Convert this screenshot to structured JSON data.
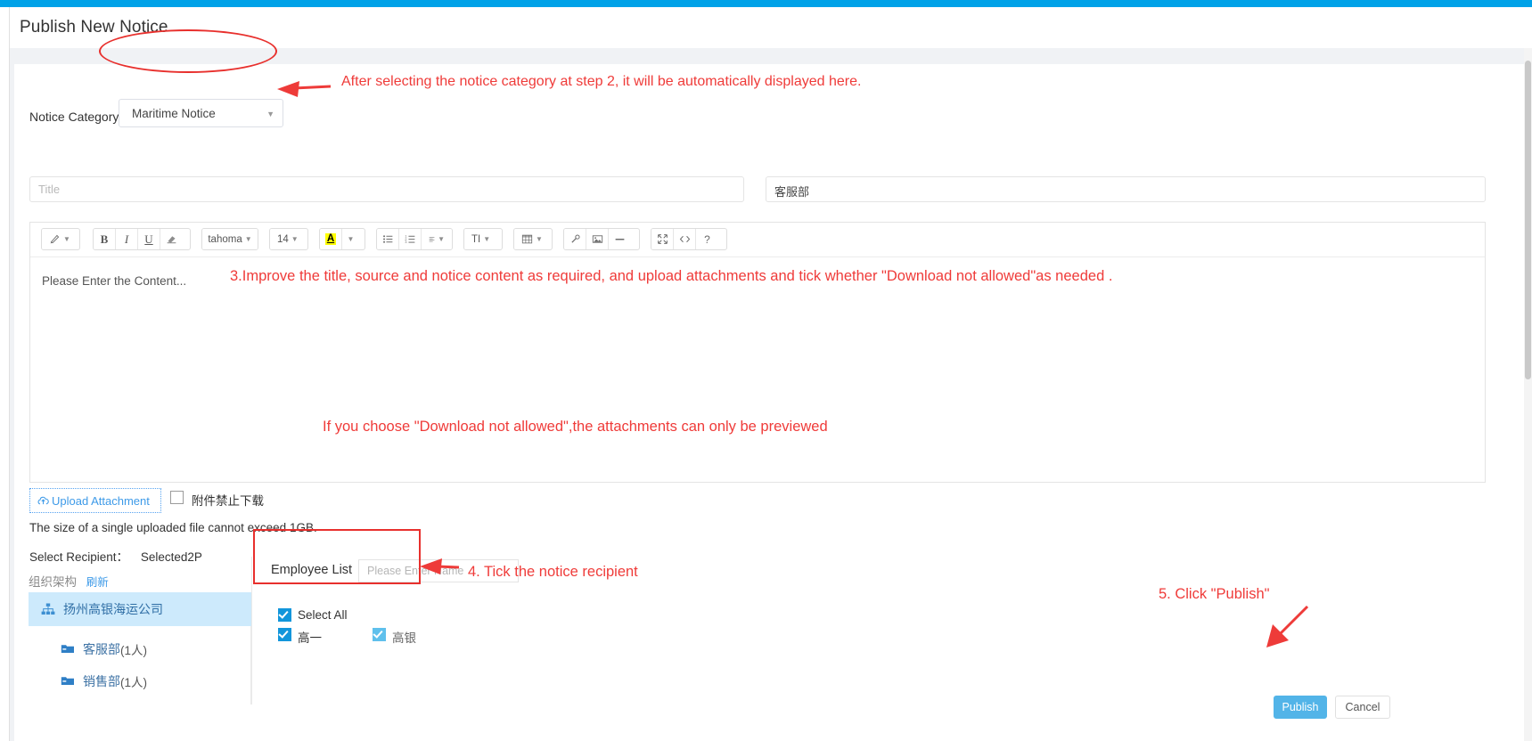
{
  "window": {
    "title": "Publish New Notice"
  },
  "form": {
    "category_label": "Notice Category",
    "category_value": "Maritime Notice",
    "category_caret": "chevron-down-icon",
    "title_placeholder": "Title",
    "source_value": "客服部"
  },
  "editor": {
    "placeholder": "Please Enter the Content...",
    "toolbar": {
      "format_painter": "format-painter-icon",
      "bold": "B",
      "italic": "I",
      "underline": "U",
      "clear_format": "eraser-icon",
      "font_name": "tahoma",
      "font_size": "14",
      "text_color": "A",
      "unordered_list": "bullet-list-icon",
      "ordered_list": "numbered-list-icon",
      "align": "align-icon",
      "line_height": "TI",
      "table": "table-icon",
      "link": "link-icon",
      "image": "image-icon",
      "horizontal_rule": "hr-icon",
      "fullscreen": "fullscreen-icon",
      "source_code": "code-icon",
      "help": "?"
    }
  },
  "attachment": {
    "upload_label": "Upload Attachment",
    "upload_icon": "cloud-upload-icon",
    "no_download_label": "附件禁止下载",
    "no_download_checked": false,
    "size_hint": "The size of a single uploaded file cannot exceed 1GB."
  },
  "recipient": {
    "label": "Select Recipient：",
    "selected_text": "Selected2P",
    "org_title": "组织架构",
    "refresh_label": "刷新",
    "tree": [
      {
        "label": "扬州高银海运公司",
        "count": "",
        "icon": "org-chart-icon",
        "level": 0,
        "selected": true
      },
      {
        "label": "客服部",
        "count": "(1人)",
        "icon": "folder-icon",
        "level": 1,
        "selected": false
      },
      {
        "label": "销售部",
        "count": "(1人)",
        "icon": "folder-icon",
        "level": 1,
        "selected": false
      }
    ],
    "employee_list_title": "Employee List",
    "search_placeholder": "Please Enter Name",
    "select_all_label": "Select All",
    "select_all_checked": true,
    "employees": [
      {
        "name": "高一",
        "checked": true,
        "dim": false
      },
      {
        "name": "高银",
        "checked": true,
        "dim": true
      }
    ]
  },
  "footer": {
    "publish_label": "Publish",
    "cancel_label": "Cancel"
  },
  "annotations": {
    "step2": "After selecting the notice category at step 2, it will be automatically displayed here.",
    "step3": "3.Improve the title, source and notice content as required, and upload attachments and tick whether \"Download not allowed\"as needed .",
    "download_note": "If you choose  \"Download not allowed\",the attachments can only be previewed",
    "step4": "4. Tick the notice recipient",
    "step5": "5. Click \"Publish\""
  },
  "colors": {
    "accent": "#00a2e8",
    "annotation_red": "#ef3b39",
    "publish_blue": "#52b4e8",
    "checkbox_blue": "#1296db"
  }
}
